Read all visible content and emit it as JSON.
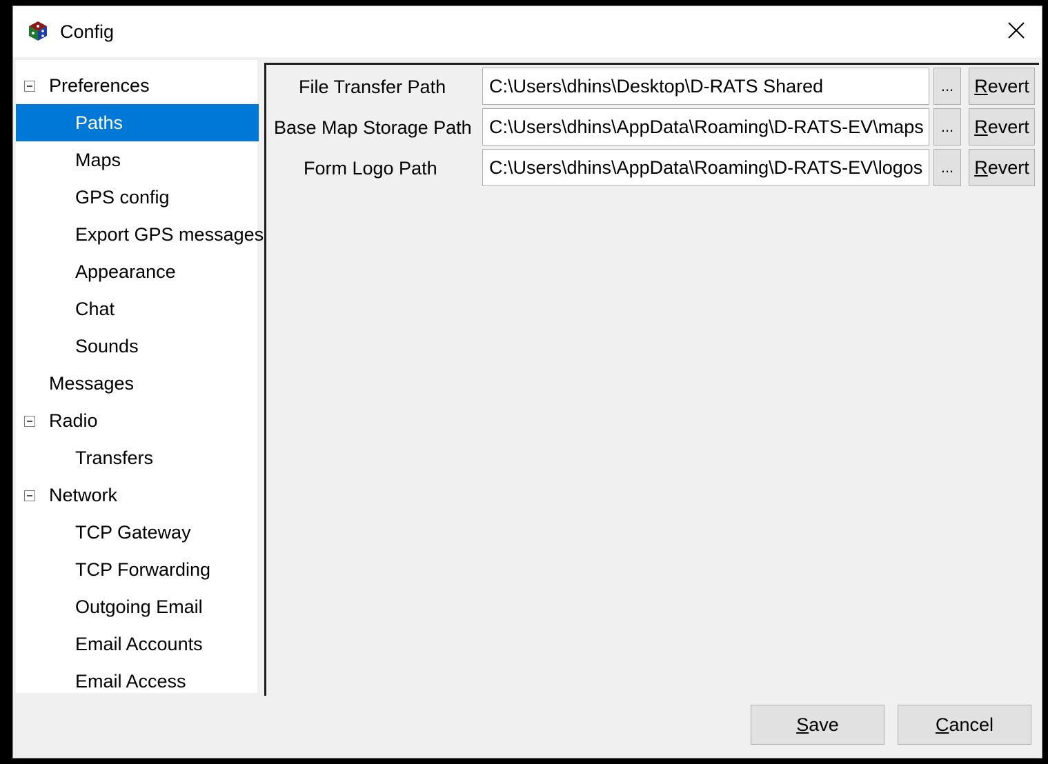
{
  "window": {
    "title": "Config"
  },
  "icons": {
    "app": "d-rats-cube-icon",
    "close": "close-icon",
    "expander": "collapse-icon"
  },
  "tree": {
    "items": [
      {
        "label": "Preferences",
        "level": 0,
        "expandable": true
      },
      {
        "label": "Paths",
        "level": 1,
        "selected": true
      },
      {
        "label": "Maps",
        "level": 1
      },
      {
        "label": "GPS config",
        "level": 1
      },
      {
        "label": "Export GPS messages",
        "level": 1
      },
      {
        "label": "Appearance",
        "level": 1
      },
      {
        "label": "Chat",
        "level": 1
      },
      {
        "label": "Sounds",
        "level": 1
      },
      {
        "label": "Messages",
        "level": 0
      },
      {
        "label": "Radio",
        "level": 0,
        "expandable": true
      },
      {
        "label": "Transfers",
        "level": 1
      },
      {
        "label": "Network",
        "level": 0,
        "expandable": true
      },
      {
        "label": "TCP Gateway",
        "level": 1
      },
      {
        "label": "TCP Forwarding",
        "level": 1
      },
      {
        "label": "Outgoing Email",
        "level": 1
      },
      {
        "label": "Email Accounts",
        "level": 1
      },
      {
        "label": "Email Access",
        "level": 1
      }
    ]
  },
  "paths": {
    "rows": [
      {
        "label": "File Transfer Path",
        "value": "C:\\Users\\dhins\\Desktop\\D-RATS Shared",
        "browse": "...",
        "revert_accel": "R",
        "revert_rest": "evert"
      },
      {
        "label": "Base Map Storage Path",
        "value": "C:\\Users\\dhins\\AppData\\Roaming\\D-RATS-EV\\maps",
        "browse": "...",
        "revert_accel": "R",
        "revert_rest": "evert"
      },
      {
        "label": "Form Logo Path",
        "value": "C:\\Users\\dhins\\AppData\\Roaming\\D-RATS-EV\\logos",
        "browse": "...",
        "revert_accel": "R",
        "revert_rest": "evert"
      }
    ]
  },
  "footer": {
    "save_accel": "S",
    "save_rest": "ave",
    "cancel_accel": "C",
    "cancel_rest": "ancel"
  }
}
